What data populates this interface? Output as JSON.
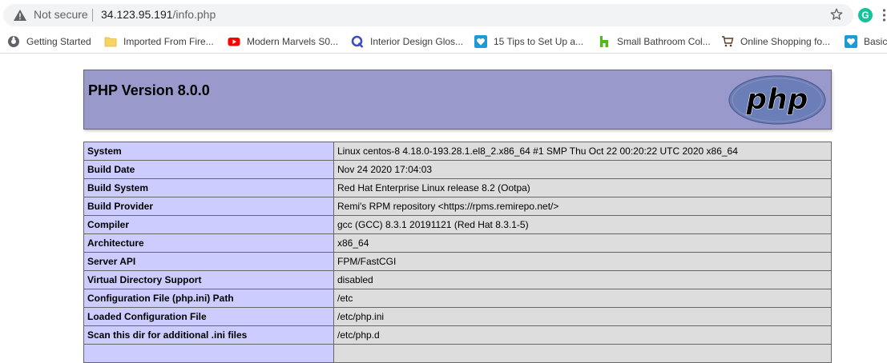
{
  "browser": {
    "security_label": "Not secure",
    "url_host": "34.123.95.191",
    "url_path": "/info.php",
    "grammarly_letter": "G"
  },
  "bookmarks": [
    {
      "label": "Getting Started",
      "icon": "gear-globe-icon"
    },
    {
      "label": "Imported From Fire...",
      "icon": "folder-icon"
    },
    {
      "label": "Modern Marvels S0...",
      "icon": "youtube-icon"
    },
    {
      "label": "Interior Design Glos...",
      "icon": "q-logo-icon"
    },
    {
      "label": "15 Tips to Set Up a...",
      "icon": "heart-icon"
    },
    {
      "label": "Small Bathroom Col...",
      "icon": "houzz-icon"
    },
    {
      "label": "Online Shopping fo...",
      "icon": "cart-icon"
    },
    {
      "label": "Basic",
      "icon": "heart-icon"
    }
  ],
  "page": {
    "title": "PHP Version 8.0.0",
    "logo_text": "php",
    "rows": [
      {
        "key": "System",
        "value": "Linux centos-8 4.18.0-193.28.1.el8_2.x86_64 #1 SMP Thu Oct 22 00:20:22 UTC 2020 x86_64"
      },
      {
        "key": "Build Date",
        "value": "Nov 24 2020 17:04:03"
      },
      {
        "key": "Build System",
        "value": "Red Hat Enterprise Linux release 8.2 (Ootpa)"
      },
      {
        "key": "Build Provider",
        "value": "Remi's RPM repository <https://rpms.remirepo.net/>"
      },
      {
        "key": "Compiler",
        "value": "gcc (GCC) 8.3.1 20191121 (Red Hat 8.3.1-5)"
      },
      {
        "key": "Architecture",
        "value": "x86_64"
      },
      {
        "key": "Server API",
        "value": "FPM/FastCGI"
      },
      {
        "key": "Virtual Directory Support",
        "value": "disabled"
      },
      {
        "key": "Configuration File (php.ini) Path",
        "value": "/etc"
      },
      {
        "key": "Loaded Configuration File",
        "value": "/etc/php.ini"
      },
      {
        "key": "Scan this dir for additional .ini files",
        "value": "/etc/php.d"
      },
      {
        "key": "",
        "value": ""
      }
    ]
  },
  "colors": {
    "header_bg": "#9999cc",
    "key_cell_bg": "#ccccff",
    "value_cell_bg": "#dddddd"
  }
}
